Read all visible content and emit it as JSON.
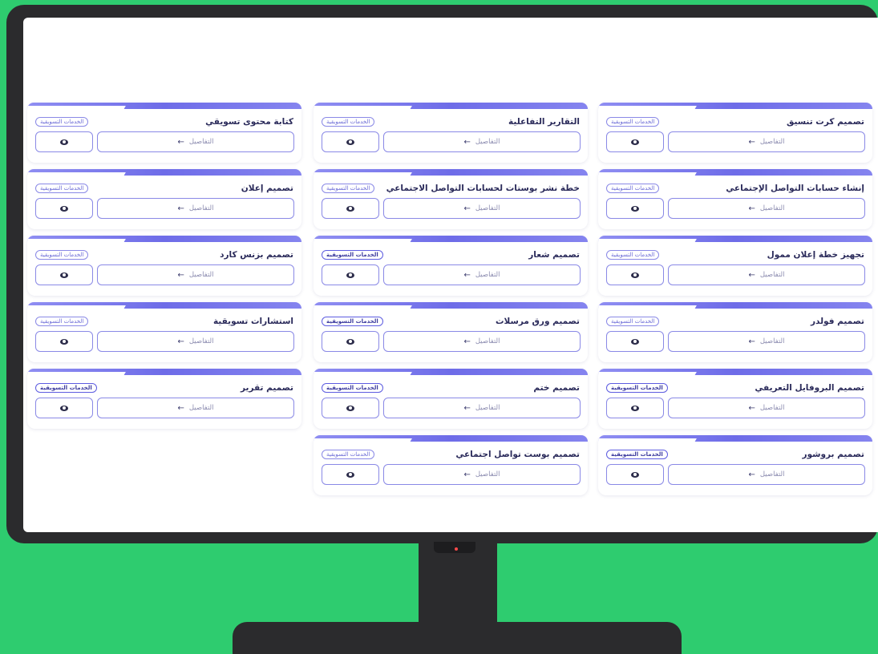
{
  "services": [
    {
      "title": "تصميم كرت تنسيق",
      "tag": "الخدمات التسويقية",
      "details": "التفاصيل",
      "tag_dark": false
    },
    {
      "title": "التقارير التفاعلية",
      "tag": "الخدمات التسويقية",
      "details": "التفاصيل",
      "tag_dark": false
    },
    {
      "title": "كتابة محتوى تسويقي",
      "tag": "الخدمات التسويقية",
      "details": "التفاصيل",
      "tag_dark": false
    },
    {
      "title": "إنشاء حسابات التواصل الإجتماعي",
      "tag": "الخدمات التسويقية",
      "details": "التفاصيل",
      "tag_dark": false
    },
    {
      "title": "خطة نشر بوستات لحسابات التواصل الاجتماعي",
      "tag": "الخدمات التسويقية",
      "details": "التفاصيل",
      "tag_dark": false
    },
    {
      "title": "تصميم إعلان",
      "tag": "الخدمات التسويقية",
      "details": "التفاصيل",
      "tag_dark": false
    },
    {
      "title": "تجهيز خطة إعلان ممول",
      "tag": "الخدمات التسويقية",
      "details": "التفاصيل",
      "tag_dark": false
    },
    {
      "title": "تصميم شعار",
      "tag": "الخدمات التسويقية",
      "details": "التفاصيل",
      "tag_dark": true
    },
    {
      "title": "تصميم بزنس كارد",
      "tag": "الخدمات التسويقية",
      "details": "التفاصيل",
      "tag_dark": false
    },
    {
      "title": "تصميم فولدر",
      "tag": "الخدمات التسويقية",
      "details": "التفاصيل",
      "tag_dark": false
    },
    {
      "title": "تصميم ورق مرسلات",
      "tag": "الخدمات التسويقية",
      "details": "التفاصيل",
      "tag_dark": true
    },
    {
      "title": "استشارات تسويقية",
      "tag": "الخدمات التسويقية",
      "details": "التفاصيل",
      "tag_dark": false
    },
    {
      "title": "تصميم البروفايل التعريفي",
      "tag": "الخدمات التسويقية",
      "details": "التفاصيل",
      "tag_dark": true
    },
    {
      "title": "تصميم ختم",
      "tag": "الخدمات التسويقية",
      "details": "التفاصيل",
      "tag_dark": true
    },
    {
      "title": "تصميم تقرير",
      "tag": "الخدمات التسويقية",
      "details": "التفاصيل",
      "tag_dark": true
    },
    {
      "title": "تصميم بروشور",
      "tag": "الخدمات التسويقية",
      "details": "التفاصيل",
      "tag_dark": true
    },
    {
      "title": "تصميم بوست تواصل اجتماعي",
      "tag": "الخدمات التسويقية",
      "details": "التفاصيل",
      "tag_dark": false
    }
  ],
  "icons": {
    "details_arrow": "arrow-left-icon",
    "view": "eye-icon"
  },
  "colors": {
    "background": "#2ecc6f",
    "accent": "#6e6ce8",
    "frame": "#2b2b2d"
  }
}
